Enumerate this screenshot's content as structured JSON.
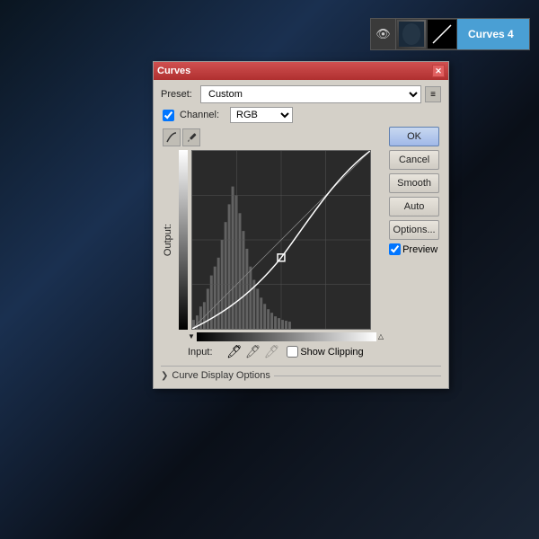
{
  "background": {
    "description": "dark blue photo background"
  },
  "layer_panel": {
    "name": "Curves 4",
    "eye_icon": "👁",
    "curves_symbol": "~"
  },
  "dialog": {
    "title": "Curves",
    "close_icon": "✕",
    "preset_label": "Preset:",
    "preset_value": "Custom",
    "preset_icon": "≡",
    "channel_label": "Channel:",
    "channel_value": "RGB",
    "output_label": "Output:",
    "input_label": "Input:",
    "show_clipping_label": "Show Clipping",
    "curve_display_options_label": "Curve Display Options",
    "expand_icon": "❯"
  },
  "buttons": {
    "ok": "OK",
    "cancel": "Cancel",
    "smooth": "Smooth",
    "auto": "Auto",
    "options": "Options...",
    "preview_label": "Preview"
  },
  "eyedroppers": [
    "🖊",
    "🖊",
    "🖊"
  ],
  "colors": {
    "titlebar_start": "#d05050",
    "titlebar_end": "#b03030",
    "accent_blue": "#4a9fd4",
    "ok_border": "#6080b0"
  }
}
